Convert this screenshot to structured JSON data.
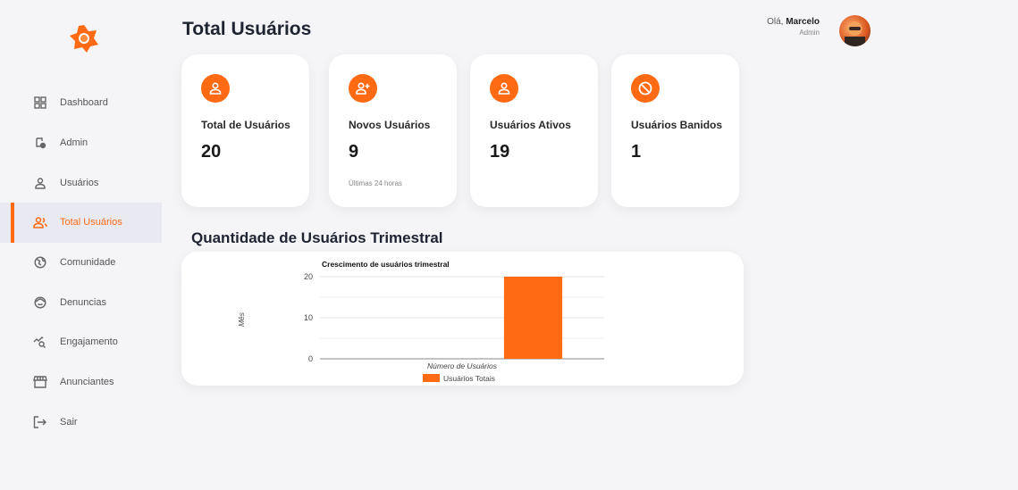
{
  "sidebar": {
    "items": [
      {
        "label": "Dashboard",
        "icon": "grid-icon",
        "active": false
      },
      {
        "label": "Admin",
        "icon": "shield-user-icon",
        "active": false
      },
      {
        "label": "Usuários",
        "icon": "user-icon",
        "active": false
      },
      {
        "label": "Total Usuários",
        "icon": "users-icon",
        "active": true
      },
      {
        "label": "Comunidade",
        "icon": "globe-icon",
        "active": false
      },
      {
        "label": "Denuncias",
        "icon": "face-icon",
        "active": false
      },
      {
        "label": "Engajamento",
        "icon": "chart-search-icon",
        "active": false
      },
      {
        "label": "Anunciantes",
        "icon": "store-icon",
        "active": false
      },
      {
        "label": "Sair",
        "icon": "logout-icon",
        "active": false
      }
    ]
  },
  "header": {
    "title": "Total Usuários",
    "greeting": "Olá,",
    "user_name": "Marcelo",
    "user_role": "Admin"
  },
  "cards": [
    {
      "label": "Total de Usuários",
      "value": "20",
      "note": "",
      "icon": "user-icon"
    },
    {
      "label": "Novos Usuários",
      "value": "9",
      "note": "Últimas 24 horas",
      "icon": "user-plus-icon"
    },
    {
      "label": "Usuários Ativos",
      "value": "19",
      "note": "",
      "icon": "user-icon"
    },
    {
      "label": "Usuários Banidos",
      "value": "1",
      "note": "",
      "icon": "ban-icon"
    }
  ],
  "section_title": "Quantidade de Usuários Trimestral",
  "colors": {
    "accent": "#ff6a13",
    "background": "#f5f5f8"
  },
  "chart_data": {
    "type": "bar",
    "title": "Crescimento de usuários trimestral",
    "xlabel": "Número de Usuários",
    "ylabel": "Mês",
    "categories": [
      "",
      ""
    ],
    "series": [
      {
        "name": "Usuários Totais",
        "values": [
          0,
          20
        ],
        "color": "#ff6a13"
      }
    ],
    "ylim": [
      0,
      20
    ],
    "yticks": [
      0,
      10,
      20
    ],
    "grid": true,
    "legend": "bottom"
  }
}
